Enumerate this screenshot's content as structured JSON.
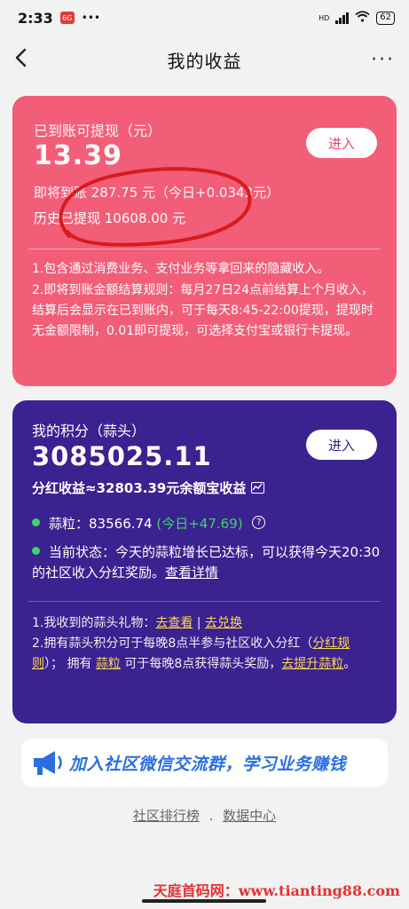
{
  "status_bar": {
    "time": "2:33",
    "app_badge": "6G",
    "hd": "HD",
    "battery": "62"
  },
  "nav": {
    "title": "我的收益"
  },
  "income_card": {
    "label": "已到账可提现（元）",
    "amount": "13.39",
    "enter_label": "进入",
    "pending": "即将到账 287.75 元（今日+0.0343元）",
    "history": "历史已提现 10608.00 元",
    "notes": [
      "1.包含通过消费业务、支付业务等拿回来的隐藏收入。",
      "2.即将到账金额结算规则：每月27日24点前结算上个月收入，结算后会显示在已到账内，可于每天8:45-22:00提现，提现时无金额限制，0.01即可提现，可选择支付宝或银行卡提现。"
    ]
  },
  "points_card": {
    "label": "我的积分（蒜头）",
    "amount": "3085025.11",
    "enter_label": "进入",
    "dividend": "分红收益≈32803.39元余额宝收益",
    "grains_label": "蒜粒：",
    "grains_value": "83566.74",
    "grains_today": "(今日+47.69)",
    "status_prefix": "当前状态：今天的蒜粒增长已达标，可以获得今天20:30的社区收入分红奖励。",
    "status_link": "查看详情",
    "note1_prefix": "1.我收到的蒜头礼物：",
    "note1_link1": "去查看",
    "note1_sep": " | ",
    "note1_link2": "去兑换",
    "note2_a": "2.拥有蒜头积分可于每晚8点半参与社区收入分红（",
    "note2_link1": "分红规则",
    "note2_b": "）；  拥有 ",
    "note2_link2": "蒜粒",
    "note2_c": " 可于每晚8点获得蒜头奖励，",
    "note2_link3": "去提升蒜粒",
    "note2_d": "。"
  },
  "banner": {
    "text": "加入社区微信交流群，学习业务赚钱"
  },
  "footer": {
    "link1": "社区排行榜",
    "sep": ".",
    "link2": "数据中心"
  },
  "watermark": {
    "text": "天庭首码网：www.tianting88.com"
  },
  "colors": {
    "pink": "#f25d78",
    "purple": "#3a2290",
    "green": "#3fd46a",
    "banner_blue": "#2a6ee0"
  }
}
